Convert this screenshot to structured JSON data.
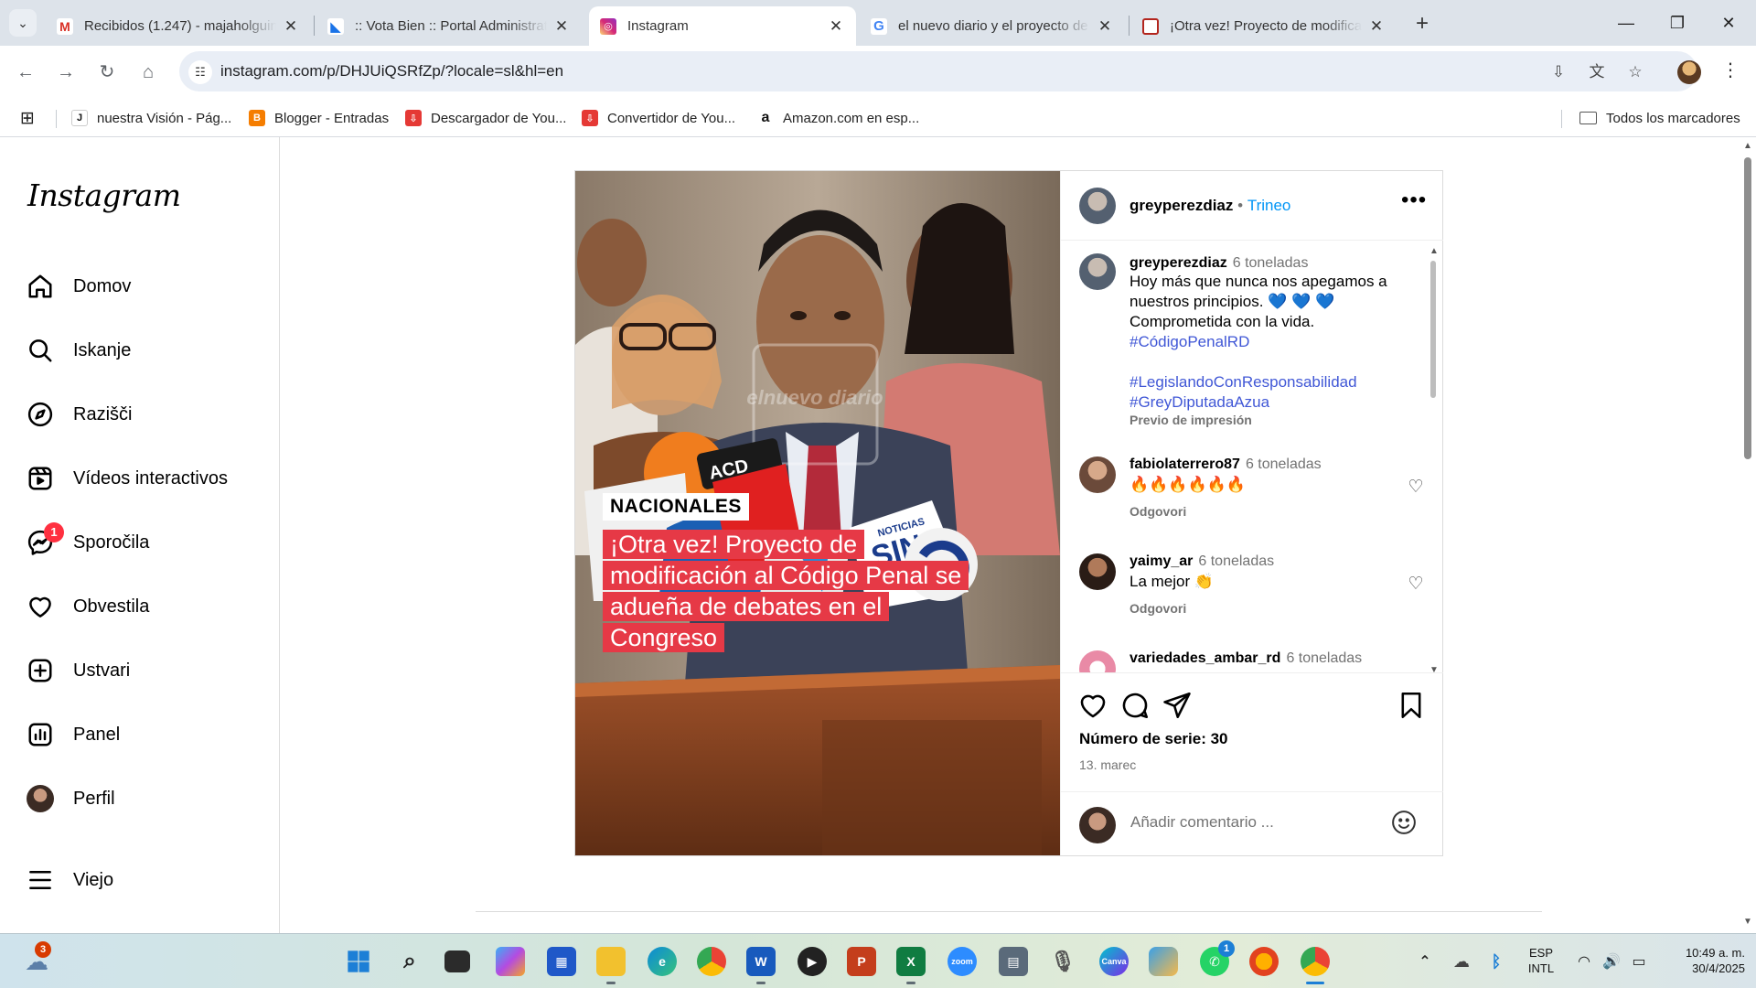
{
  "browser": {
    "tabs": [
      {
        "title": "Recibidos (1.247) - majaholguin",
        "favicon": "gmail-icon",
        "active": false
      },
      {
        "title": ":: Vota Bien :: Portal Administrat",
        "favicon": "vota-bien-icon",
        "active": false
      },
      {
        "title": "Instagram",
        "favicon": "instagram-icon",
        "active": true
      },
      {
        "title": "el nuevo diario y el proyecto de",
        "favicon": "google-icon",
        "active": false
      },
      {
        "title": "¡Otra vez! Proyecto de modifica",
        "favicon": "el-nuevo-diario-icon",
        "active": false
      }
    ],
    "url": "instagram.com/p/DHJUiQSRfZp/?locale=sl&hl=en",
    "bookmarks": [
      {
        "label": "nuestra Visión - Pág...",
        "icon": "j-icon"
      },
      {
        "label": "Blogger - Entradas",
        "icon": "blogger-icon"
      },
      {
        "label": "Descargador de You...",
        "icon": "download-icon"
      },
      {
        "label": "Convertidor de You...",
        "icon": "download-icon"
      },
      {
        "label": "Amazon.com en esp...",
        "icon": "amazon-icon"
      }
    ],
    "all_bookmarks": "Todos los marcadores"
  },
  "instagram": {
    "logo": "Instagram",
    "nav": [
      {
        "label": "Domov",
        "icon": "home-icon"
      },
      {
        "label": "Iskanje",
        "icon": "search-icon"
      },
      {
        "label": "Razišči",
        "icon": "compass-icon"
      },
      {
        "label": "Vídeos interactivos",
        "icon": "reels-icon"
      },
      {
        "label": "Sporočila",
        "icon": "messenger-icon",
        "badge": "1"
      },
      {
        "label": "Obvestila",
        "icon": "heart-icon"
      },
      {
        "label": "Ustvari",
        "icon": "plus-square-icon"
      },
      {
        "label": "Panel",
        "icon": "chart-icon"
      },
      {
        "label": "Perfil",
        "icon": "profile-avatar"
      },
      {
        "label": "Viejo",
        "icon": "menu-icon"
      }
    ],
    "post": {
      "image": {
        "watermark": "elnuevo diario",
        "section": "NACIONALES",
        "headline": [
          "¡Otra vez! Proyecto de",
          "modificación al Código Penal se",
          "adueña de debates en el",
          "Congreso"
        ],
        "mic_labels": [
          "ACD",
          "SIN",
          "NOTICIAS"
        ]
      },
      "header": {
        "username": "greyperezdiaz",
        "separator": "•",
        "follow": "Trineo"
      },
      "caption": {
        "username": "greyperezdiaz",
        "time": "6 toneladas",
        "lines": [
          "Hoy más que nunca nos apegamos a",
          "nuestros principios. 💙 💙 💙",
          "Comprometida con la vida."
        ],
        "hashtags": [
          "#CódigoPenalRD",
          "#LegislandoConResponsabilidad",
          "#GreyDiputadaAzua"
        ],
        "see_translation": "Previo de impresión"
      },
      "comments": [
        {
          "username": "fabiolaterrero87",
          "time": "6 toneladas",
          "text": "🔥🔥🔥🔥🔥🔥",
          "reply": "Odgovori"
        },
        {
          "username": "yaimy_ar",
          "time": "6 toneladas",
          "text": "La mejor 👏",
          "reply": "Odgovori"
        },
        {
          "username": "variedades_ambar_rd",
          "time": "6 toneladas",
          "text": "",
          "reply": ""
        }
      ],
      "likes": "Número de serie: 30",
      "date": "13. marec",
      "add_comment_placeholder": "Añadir comentario ..."
    }
  },
  "taskbar": {
    "weather_badge": "3",
    "whatsapp_badge": "1",
    "lang": "ESP",
    "layout": "INTL",
    "time": "10:49 a. m.",
    "date": "30/4/2025"
  },
  "colors": {
    "accent_blue": "#0095f6",
    "hashtag": "#4057d6",
    "badge_red": "#ff3040",
    "headline_red": "#e63946"
  }
}
